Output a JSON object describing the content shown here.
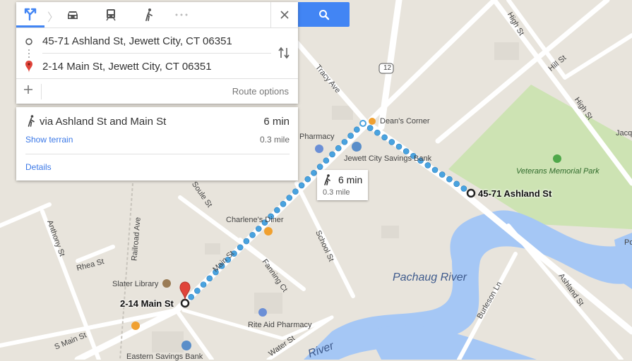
{
  "modes": [
    {
      "name": "best-route",
      "icon": "directions-icon",
      "active": true
    },
    {
      "name": "driving",
      "icon": "car-icon",
      "active": false
    },
    {
      "name": "transit",
      "icon": "train-icon",
      "active": false
    },
    {
      "name": "walking",
      "icon": "walking-icon",
      "active": false
    },
    {
      "name": "more",
      "icon": "more-dots-icon",
      "active": false
    }
  ],
  "origin": "45-71 Ashland St, Jewett City, CT 06351",
  "destination": "2-14 Main St, Jewett City, CT 06351",
  "route_options": "Route options",
  "route": {
    "title": "via Ashland St and Main St",
    "time": "6 min",
    "distance": "0.3 mile",
    "show_terrain": "Show terrain",
    "details": "Details"
  },
  "tooltip": {
    "time": "6 min",
    "distance": "0.3 mile"
  },
  "map_labels": {
    "pharmacy": "Pharmacy",
    "deans_corner": "Dean's Corner",
    "savings_bank": "Jewett City Savings Bank",
    "veterans_park": "Veterans Memorial Park",
    "jacq": "Jacq",
    "origin_addr": "45-71 Ashland St",
    "dest_addr": "2-14 Main St",
    "charlenes": "Charlene's Diner",
    "slater": "Slater Library",
    "rite_aid": "Rite Aid Pharmacy",
    "eastern_bank": "Eastern Savings Bank",
    "pachaug_river": "Pachaug River",
    "river": "River",
    "tracy_ave": "Tracy Ave",
    "high_st_1": "High St",
    "high_st_2": "High St",
    "hill_st": "Hill St",
    "soule_st": "Soule St",
    "railroad_ave": "Railroad Ave",
    "anthony_st": "Anthony St",
    "rhea_st": "Rhea St",
    "main_st": "Main St",
    "fanning_ct": "Fanning Ct",
    "school_st": "School St",
    "burleson_ln": "Burleson Ln",
    "ashland_st": "Ashland St",
    "s_main_st": "S Main St",
    "water_st": "Water St",
    "route_12": "12",
    "po": "Po"
  },
  "colors": {
    "accent": "#4285f4",
    "route": "#4aa3df",
    "park": "#cde3b3",
    "water": "#a5c7f5",
    "marker": "#e0443a"
  }
}
